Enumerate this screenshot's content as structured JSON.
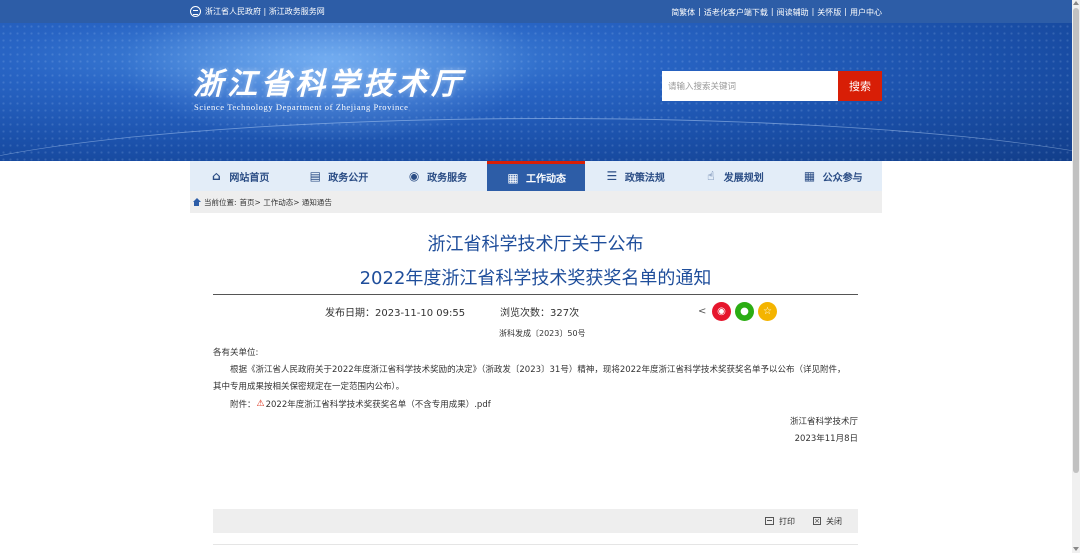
{
  "topbar": {
    "left_text": "浙江省人民政府 | 浙江政务服务网",
    "links": [
      "简繁体",
      "|",
      "适老化客户端下载",
      "|",
      "阅读辅助",
      "|",
      "关怀版",
      "|",
      "用户中心"
    ]
  },
  "header": {
    "logo_cn": "浙江省科学技术厅",
    "logo_en": "Science Technology Department of Zhejiang Province",
    "search_placeholder": "请输入搜索关键词",
    "search_button": "搜索"
  },
  "nav": {
    "items": [
      {
        "label": "网站首页",
        "icon": "home-icon"
      },
      {
        "label": "政务公开",
        "icon": "newspaper-icon"
      },
      {
        "label": "政务服务",
        "icon": "chat-icon"
      },
      {
        "label": "工作动态",
        "icon": "dashboard-icon",
        "active": true
      },
      {
        "label": "政策法规",
        "icon": "document-icon"
      },
      {
        "label": "发展规划",
        "icon": "handshake-icon"
      },
      {
        "label": "公众参与",
        "icon": "people-icon"
      }
    ]
  },
  "breadcrumb": {
    "label": "当前位置:",
    "path": "首页>  工作动态>  通知通告"
  },
  "article": {
    "title_line1": "浙江省科学技术厅关于公布",
    "title_line2": "2022年度浙江省科学技术奖获奖名单的通知",
    "publish_date": "发布日期：2023-11-10 09:55",
    "views": "浏览次数：327次",
    "doc_number": "浙科发成〔2023〕50号",
    "recipient": "各有关单位:",
    "para1": "根据《浙江省人民政府关于2022年度浙江省科学技术奖励的决定》（浙政发〔2023〕31号）精神，现将2022年度浙江省科学技术奖获奖名单予以公布（详见附件，",
    "para2": "其中专用成果按相关保密规定在一定范围内公布）。",
    "attachment_label": "附件：",
    "attachment_file": "2022年度浙江省科学技术奖获奖名单（不含专用成果）.pdf",
    "signature": "浙江省科学技术厅",
    "signature_date": "2023年11月8日"
  },
  "actions": {
    "print": "打印",
    "close": "关闭"
  },
  "colors": {
    "brand_blue": "#2d5da7",
    "title_blue": "#1f4e9b",
    "accent_red": "#d81e06"
  }
}
